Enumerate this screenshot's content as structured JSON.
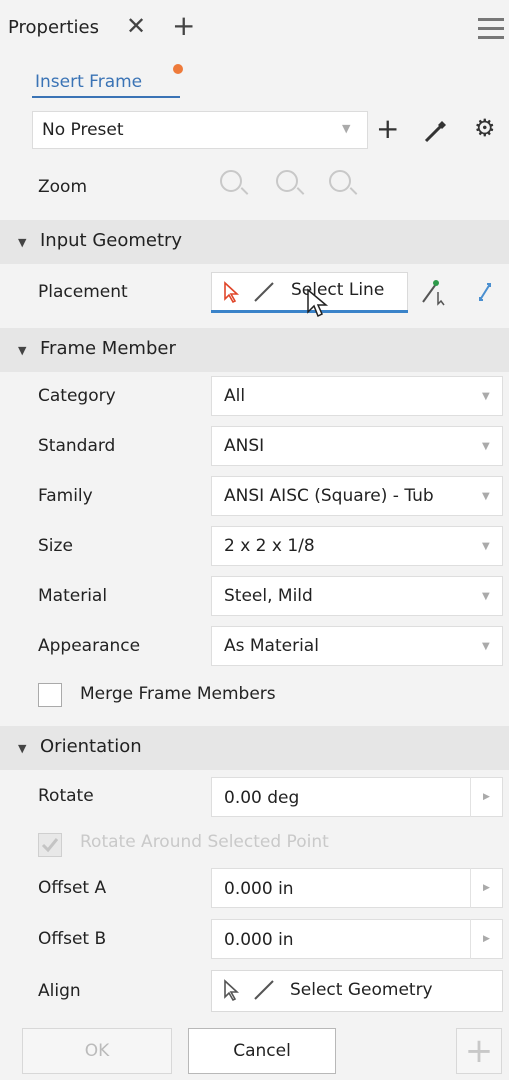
{
  "window": {
    "tab_title": "Properties",
    "tab_close": "✕",
    "tab_add": "+"
  },
  "command": {
    "tab_label": "Insert Frame"
  },
  "preset": {
    "value": "No Preset",
    "add": "+"
  },
  "zoom": {
    "label": "Zoom"
  },
  "sections": {
    "input_geometry": "Input Geometry",
    "frame_member": "Frame Member",
    "orientation": "Orientation"
  },
  "input_geometry": {
    "placement_label": "Placement",
    "placement_value": "Select Line"
  },
  "frame_member": {
    "rows": [
      {
        "label": "Category",
        "value": "All"
      },
      {
        "label": "Standard",
        "value": "ANSI"
      },
      {
        "label": "Family",
        "value": "ANSI AISC (Square) - Tub"
      },
      {
        "label": "Size",
        "value": "2 x 2 x 1/8"
      },
      {
        "label": "Material",
        "value": "Steel, Mild"
      },
      {
        "label": "Appearance",
        "value": "As Material"
      }
    ],
    "merge_label": "Merge Frame Members",
    "merge_checked": false
  },
  "orientation": {
    "rotate_label": "Rotate",
    "rotate_value": "0.00 deg",
    "rotate_point_label": "Rotate Around Selected Point",
    "rotate_point_checked": true,
    "offset_a_label": "Offset A",
    "offset_a_value": "0.000 in",
    "offset_b_label": "Offset B",
    "offset_b_value": "0.000 in",
    "align_label": "Align",
    "align_value": "Select Geometry"
  },
  "footer": {
    "ok": "OK",
    "cancel": "Cancel",
    "add": "+"
  },
  "colors": {
    "accent": "#3a73b5",
    "notify_dot": "#ee7a3a",
    "section_bg": "#e6e6e6"
  }
}
